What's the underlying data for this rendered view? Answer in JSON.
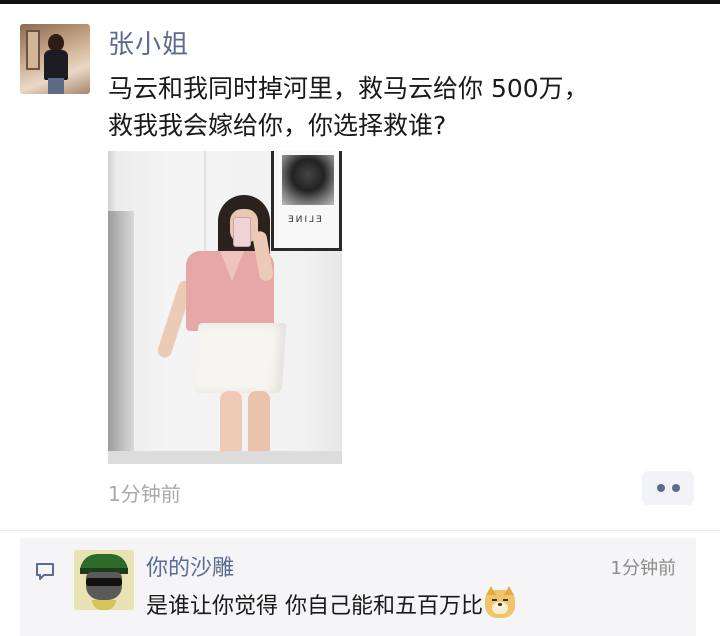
{
  "post": {
    "author": "张小姐",
    "text_lines": [
      "马云和我同时掉河里，救马云给你 500万，",
      "救我我会嫁给你，你选择救谁?"
    ],
    "time": "1分钟前",
    "photo": {
      "poster_text": "ELINE"
    }
  },
  "comment": {
    "author": "你的沙雕",
    "time": "1分钟前",
    "text": "是谁让你觉得 你自己能和五百万比",
    "emoji": "doge-emoji"
  },
  "colors": {
    "name_link": "#5b6b91",
    "time_gray": "#a9a9a9",
    "comment_bg": "#f5f5f7"
  }
}
